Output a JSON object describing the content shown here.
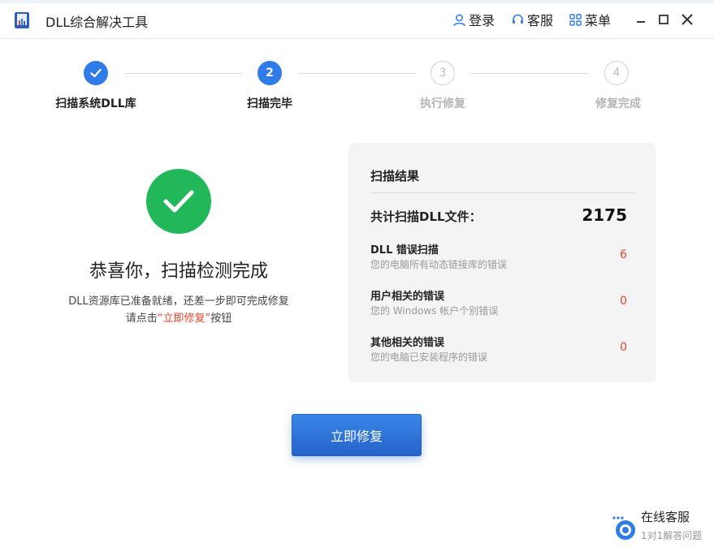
{
  "window": {
    "title": "DLL综合解决工具",
    "login_label": "登录",
    "service_label": "客服",
    "menu_label": "菜单"
  },
  "steps": [
    {
      "number": "1",
      "label": "扫描系统DLL库",
      "state": "done"
    },
    {
      "number": "2",
      "label": "扫描完毕",
      "state": "active"
    },
    {
      "number": "3",
      "label": "执行修复",
      "state": "todo"
    },
    {
      "number": "4",
      "label": "修复完成",
      "state": "todo"
    }
  ],
  "result": {
    "headline": "恭喜你，扫描检测完成",
    "desc_line1": "DLL资源库已准备就绪，还差一步即可完成修复",
    "desc_line2_prefix": "请点击",
    "desc_line2_link": "“立即修复”",
    "desc_line2_suffix": "按钮"
  },
  "scan_card": {
    "title": "扫描结果",
    "total_label": "共计扫描DLL文件：",
    "total_value": "2175",
    "rows": [
      {
        "title": "DLL 错误扫描",
        "subtitle": "您的电脑所有动态链接库的错误",
        "value": "6"
      },
      {
        "title": "用户相关的错误",
        "subtitle": "您的 Windows 帐户个别错误",
        "value": "0"
      },
      {
        "title": "其他相关的错误",
        "subtitle": "您的电脑已安装程序的错误",
        "value": "0"
      }
    ]
  },
  "repair_button_label": "立即修复",
  "online_service": {
    "title": "在线客服",
    "subtitle": "1对1解答问题"
  },
  "colors": {
    "accent_blue": "#2f7be8",
    "success_green": "#22b85a",
    "error_red": "#e5432f",
    "card_bg": "#f4f4f4"
  }
}
